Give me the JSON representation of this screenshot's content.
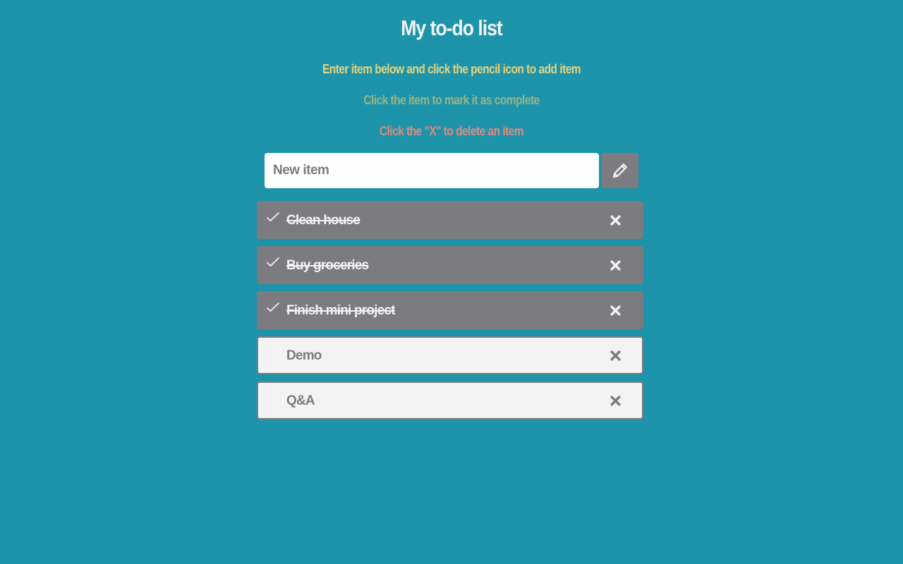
{
  "header": {
    "title": "My to-do list"
  },
  "instructions": [
    "Enter item below and click the pencil icon to add item",
    "Click the item to mark it as complete",
    "Click the \"X\" to delete an item"
  ],
  "input": {
    "placeholder": "New item",
    "value": ""
  },
  "add_button": {
    "icon": "pencil-icon"
  },
  "items": [
    {
      "label": "Clean house",
      "completed": true
    },
    {
      "label": "Buy groceries",
      "completed": true
    },
    {
      "label": "Finish mini project",
      "completed": true
    },
    {
      "label": "Demo",
      "completed": false
    },
    {
      "label": "Q&A",
      "completed": false
    }
  ],
  "colors": {
    "background": "#1e94ab",
    "title": "#f2f2f2",
    "instruction_1": "#e7d37a",
    "instruction_2": "#97b487",
    "instruction_3": "#e2897a",
    "completed_item_bg": "#7c7b80",
    "open_item_bg": "#f3f3f3"
  }
}
